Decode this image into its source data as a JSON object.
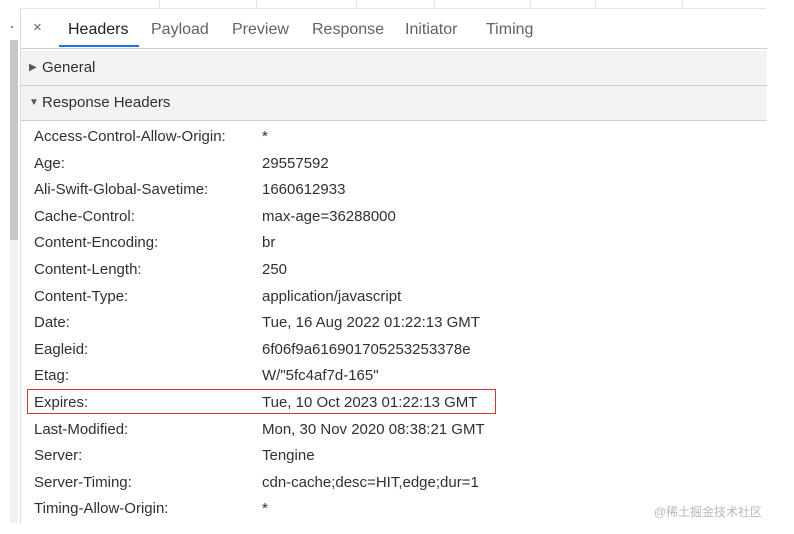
{
  "tabs": {
    "close_symbol": "×",
    "items": [
      "Headers",
      "Payload",
      "Preview",
      "Response",
      "Initiator",
      "Timing"
    ],
    "active": "Headers"
  },
  "sections": {
    "general": {
      "arrow": "▶",
      "label": "General"
    },
    "response_headers": {
      "arrow": "▼",
      "label": "Response Headers"
    }
  },
  "headers": [
    {
      "name": "Access-Control-Allow-Origin:",
      "value": "*"
    },
    {
      "name": "Age:",
      "value": "29557592"
    },
    {
      "name": "Ali-Swift-Global-Savetime:",
      "value": "1660612933"
    },
    {
      "name": "Cache-Control:",
      "value": "max-age=36288000"
    },
    {
      "name": "Content-Encoding:",
      "value": "br"
    },
    {
      "name": "Content-Length:",
      "value": "250"
    },
    {
      "name": "Content-Type:",
      "value": "application/javascript"
    },
    {
      "name": "Date:",
      "value": "Tue, 16 Aug 2022 01:22:13 GMT"
    },
    {
      "name": "Eagleid:",
      "value": "6f06f9a616901705253253378e"
    },
    {
      "name": "Etag:",
      "value": "W/\"5fc4af7d-165\""
    },
    {
      "name": "Expires:",
      "value": "Tue, 10 Oct 2023 01:22:13 GMT"
    },
    {
      "name": "Last-Modified:",
      "value": "Mon, 30 Nov 2020 08:38:21 GMT"
    },
    {
      "name": "Server:",
      "value": "Tengine"
    },
    {
      "name": "Server-Timing:",
      "value": "cdn-cache;desc=HIT,edge;dur=1"
    },
    {
      "name": "Timing-Allow-Origin:",
      "value": "*"
    }
  ],
  "highlighted_header": "Expires:",
  "highlight_color": "#d9363a",
  "accent_color": "#1a73e8",
  "watermark": "@稀土掘金技术社区"
}
